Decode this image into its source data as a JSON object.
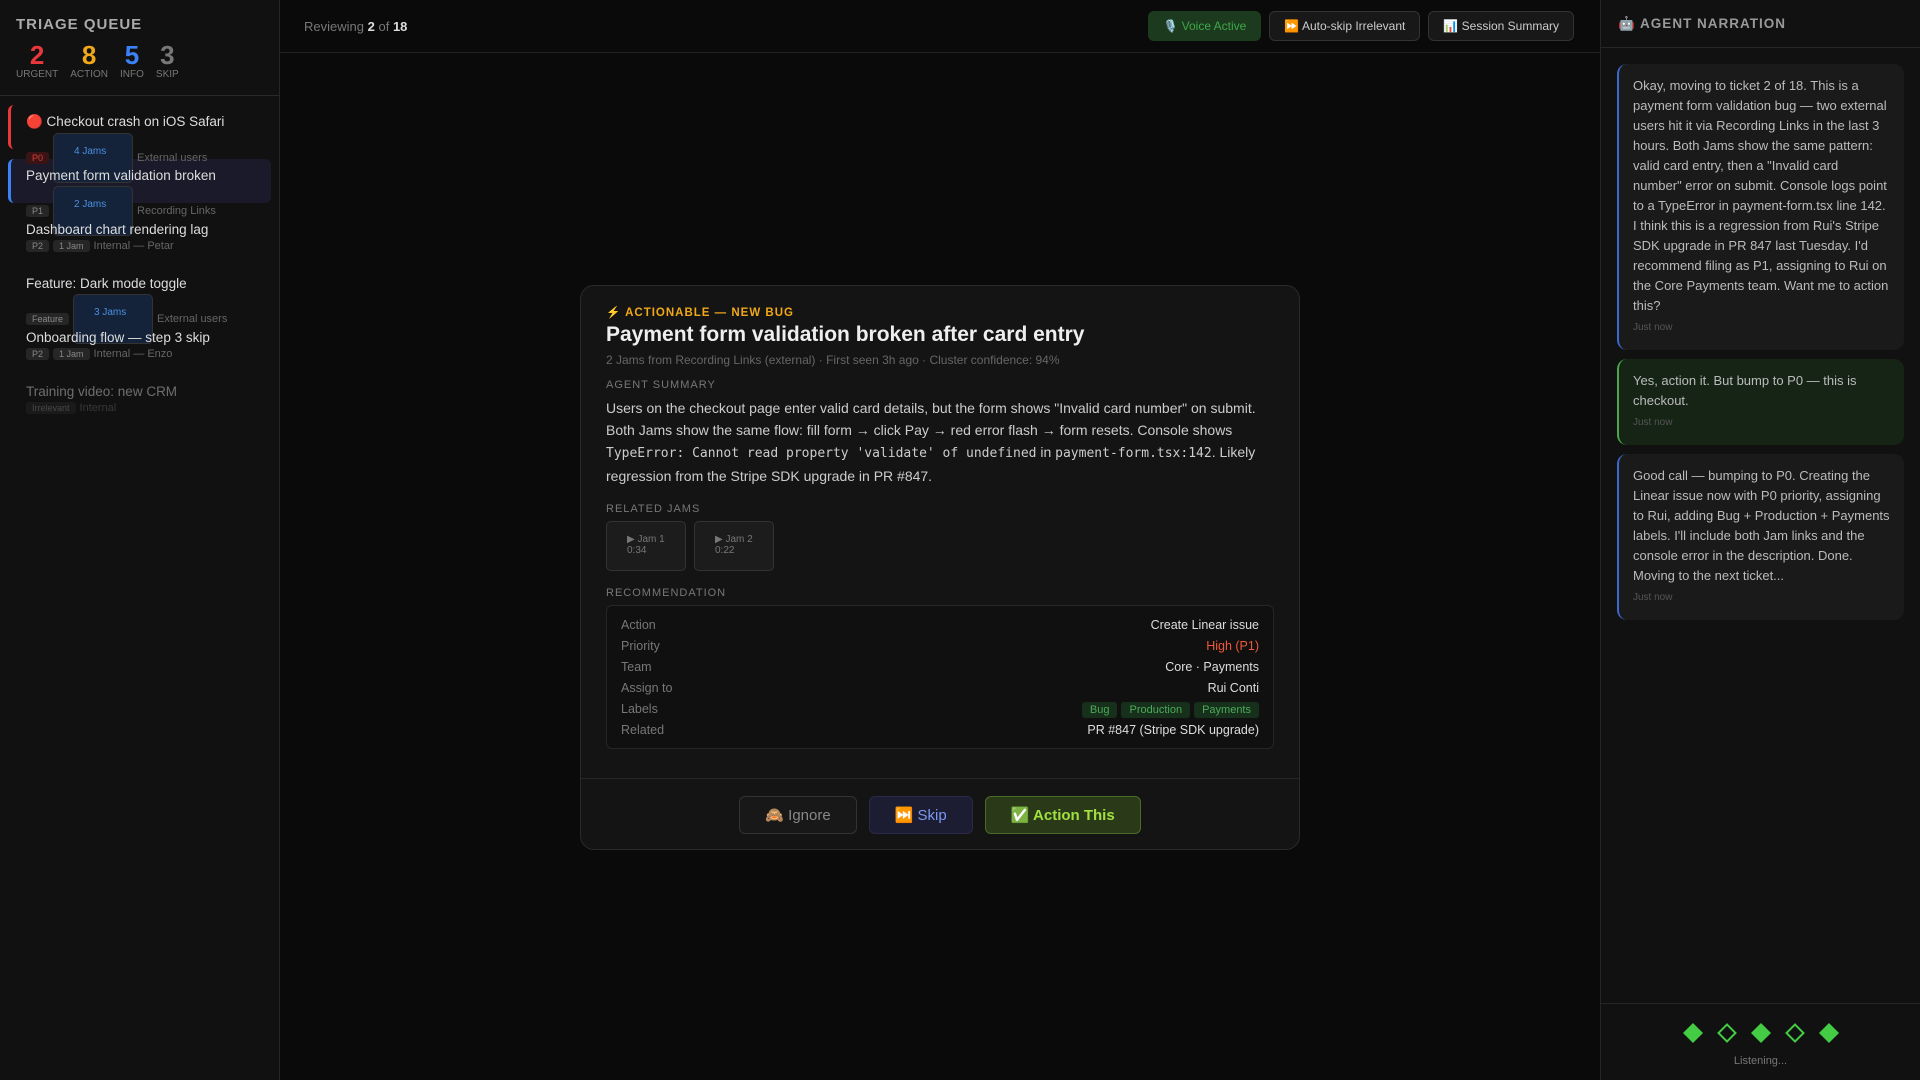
{
  "sidebar": {
    "title": "TRIAGE QUEUE",
    "stats": [
      {
        "value": "2",
        "label": "URGENT",
        "color": "#e8383a"
      },
      {
        "value": "8",
        "label": "ACTION",
        "color": "#f0a818"
      },
      {
        "value": "5",
        "label": "INFO",
        "color": "#3b82f6"
      },
      {
        "value": "3",
        "label": "SKIP",
        "color": "#777777"
      }
    ],
    "items": [
      {
        "title": "🔴 Checkout crash on iOS Safari",
        "priority": "P0",
        "jams": "4 Jams",
        "source": "External users"
      },
      {
        "title": "Payment form validation broken",
        "priority": "P1",
        "jams": "2 Jams",
        "source": "Recording Links"
      },
      {
        "title": "Dashboard chart rendering lag",
        "priority": "P2",
        "jams": "1 Jam",
        "source": "Internal — Petar"
      },
      {
        "title": "Feature: Dark mode toggle",
        "priority": "Feature",
        "jams": "3 Jams",
        "source": "External users"
      },
      {
        "title": "Onboarding flow — step 3 skip",
        "priority": "P2",
        "jams": "1 Jam",
        "source": "Internal — Enzo"
      },
      {
        "title": "Training video: new CRM",
        "priority": "Irrelevant",
        "source": "Internal"
      }
    ]
  },
  "topbar": {
    "reviewing": "Reviewing",
    "current": "2",
    "of": "of",
    "total": "18",
    "voice": "🎙️ Voice Active",
    "autoskip": "⏩ Auto-skip Irrelevant",
    "summary": "📊 Session Summary"
  },
  "card": {
    "kind": "⚡ ACTIONABLE — NEW BUG",
    "title": "Payment form validation broken after card entry",
    "meta": "2 Jams from Recording Links (external) · First seen 3h ago · Cluster confidence: 94%",
    "summary_label": "AGENT SUMMARY",
    "summary_1": "Users on the checkout page enter valid card details, but the form shows \"Invalid card number\" on submit. Both Jams show the same flow: fill form → click Pay → red error flash → form resets. Console shows ",
    "summary_code": "TypeError: Cannot read property 'validate' of undefined",
    "summary_in": " in ",
    "summary_file": "payment-form.tsx:142",
    "summary_2": ". Likely regression from the Stripe SDK upgrade in PR #847.",
    "jams_label": "RELATED JAMS",
    "jams": [
      {
        "name": "▶ Jam 1",
        "duration": "0:34"
      },
      {
        "name": "▶ Jam 2",
        "duration": "0:22"
      }
    ],
    "rec_label": "RECOMMENDATION",
    "rec": {
      "action_k": "Action",
      "action_v": "Create Linear issue",
      "priority_k": "Priority",
      "priority_v": "High (P1)",
      "team_k": "Team",
      "team_v": "Core · Payments",
      "assign_k": "Assign to",
      "assign_v": "Rui Conti",
      "labels_k": "Labels",
      "labels": [
        "Bug",
        "Production",
        "Payments"
      ],
      "related_k": "Related",
      "related_v": "PR #847 (Stripe SDK upgrade)"
    },
    "ignore": "🙈 Ignore",
    "skip": "⏭️ Skip",
    "action": "✅ Action This"
  },
  "narration": {
    "title": "🤖 AGENT NARRATION",
    "messages": [
      {
        "text": "Okay, moving to ticket 2 of 18. This is a payment form validation bug — two external users hit it via Recording Links in the last 3 hours. Both Jams show the same pattern: valid card entry, then a \"Invalid card number\" error on submit. Console logs point to a TypeError in payment-form.tsx line 142. I think this is a regression from Rui's Stripe SDK upgrade in PR 847 last Tuesday. I'd recommend filing as P1, assigning to Rui on the Core Payments team. Want me to action this?",
        "time": "Just now"
      },
      {
        "text": "Yes, action it. But bump to P0 — this is checkout.",
        "time": "Just now"
      },
      {
        "text": "Good call — bumping to P0. Creating the Linear issue now with P0 priority, assigning to Rui, adding Bug + Production + Payments labels. I'll include both Jam links and the console error in the description. Done. Moving to the next ticket...",
        "time": "Just now"
      }
    ],
    "status": "Listening..."
  }
}
